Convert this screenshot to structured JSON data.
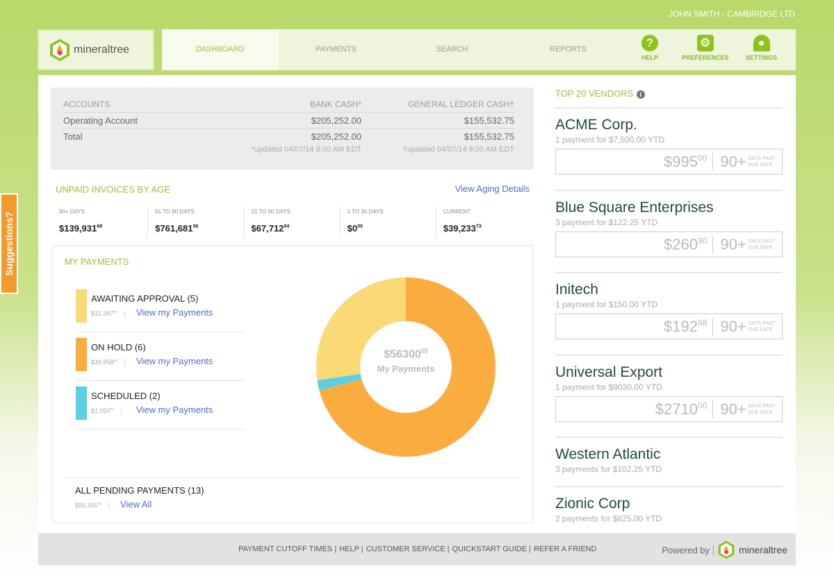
{
  "user": "JOHN SMITH - CAMBRIDGE LTD",
  "brand": "mineraltree",
  "nav": [
    {
      "label": "DASHBOARD"
    },
    {
      "label": "PAYMENTS"
    },
    {
      "label": "SEARCH"
    },
    {
      "label": "REPORTS"
    }
  ],
  "icons": {
    "help": "HELP",
    "preferences": "PREFERENCES",
    "settings": "SETTINGS"
  },
  "accounts": {
    "headers": [
      "ACCOUNTS",
      "BANK CASH*",
      "GENERAL LEDGER CASH†"
    ],
    "rows": [
      [
        "Operating Account",
        "$205,252.00",
        "$155,532.75"
      ],
      [
        "Total",
        "$205,252.00",
        "$155,532.75"
      ]
    ],
    "bank_updated": "*updated 04/07/14 9:00 AM EDT",
    "gl_updated": "†updated 04/07/14 9:00 AM EDT"
  },
  "aging": {
    "title": "UNPAID INVOICES BY AGE",
    "link": "View Aging Details",
    "items": [
      {
        "label": "90+ DAYS",
        "value": "$139,931",
        "cents": "68"
      },
      {
        "label": "61 TO 90 DAYS",
        "value": "$761,681",
        "cents": "06"
      },
      {
        "label": "31 TO 60 DAYS",
        "value": "$67,712",
        "cents": "94"
      },
      {
        "label": "1 TO 30 DAYS",
        "value": "$0",
        "cents": "00"
      },
      {
        "label": "CURRENT",
        "value": "$39,233",
        "cents": "73"
      }
    ]
  },
  "my_payments": {
    "title": "MY PAYMENTS",
    "items": [
      {
        "title": "AWAITING APPROVAL (5)",
        "amount": "$15,397",
        "cents": "00",
        "link": "View my Payments",
        "color": "#fcd977",
        "value": 15397
      },
      {
        "title": "ON HOLD (6)",
        "amount": "$39,858",
        "cents": "05",
        "link": "View my Payments",
        "color": "#fbac3f",
        "value": 39858
      },
      {
        "title": "SCHEDULED (2)",
        "amount": "$1,050",
        "cents": "00",
        "link": "View my Payments",
        "color": "#5bcfe4",
        "value": 1050
      }
    ],
    "all": {
      "title": "ALL PENDING PAYMENTS (13)",
      "amount": "$56,305",
      "cents": "05",
      "link": "View All"
    },
    "center_amount": "$56300",
    "center_cents": "05",
    "center_label": "My Payments"
  },
  "vendors": {
    "title": "TOP 20 VENDORS",
    "items": [
      {
        "name": "ACME Corp.",
        "sub": "1 payment for $7,500.00 YTD",
        "amount": "$995",
        "cents": "00",
        "days": "90+"
      },
      {
        "name": "Blue Square Enterprises",
        "sub": "3 payment for $122.25 YTD",
        "amount": "$260",
        "cents": "90",
        "days": "90+"
      },
      {
        "name": "Initech",
        "sub": "1 payment for $150.00 YTD",
        "amount": "$192",
        "cents": "98",
        "days": "90+"
      },
      {
        "name": "Universal Export",
        "sub": "1 payment for $9030.00 YTD",
        "amount": "$2710",
        "cents": "00",
        "days": "90+"
      },
      {
        "name": "Western Atlantic",
        "sub": "3 payments for $102.25 YTD"
      },
      {
        "name": "Zionic Corp",
        "sub": "2 payments for $625.00 YTD"
      }
    ],
    "days_label_1": "DAYS PAST",
    "days_label_2": "DUE DATE"
  },
  "footer": {
    "links": [
      "PAYMENT CUTOFF TIMES |",
      "HELP |",
      "CUSTOMER SERVICE |",
      "QUICKSTART GUIDE |",
      "REFER A FRIEND"
    ],
    "powered": "Powered by"
  },
  "suggestions": "Suggestions?"
}
